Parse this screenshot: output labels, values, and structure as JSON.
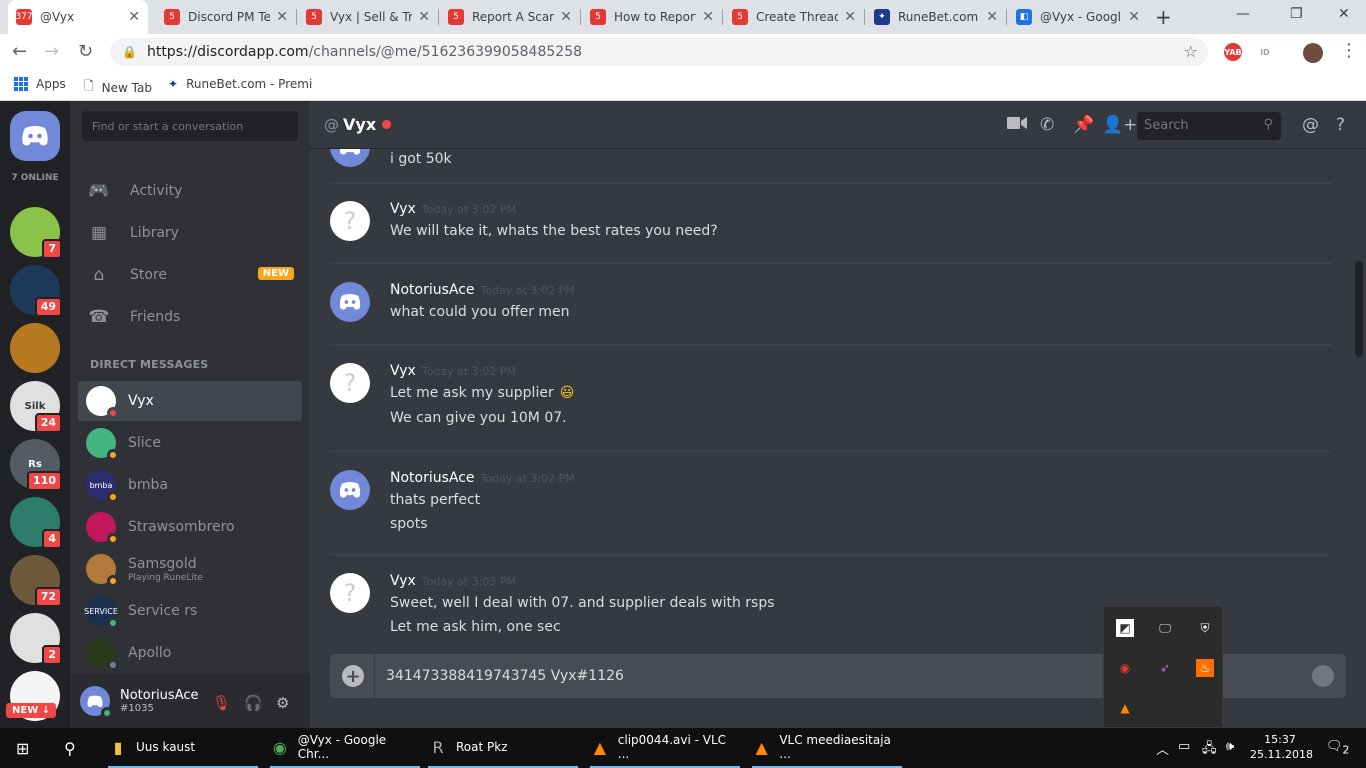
{
  "browser": {
    "tabs": [
      {
        "title": "@Vyx",
        "fav_text": "377",
        "fav_color": "#e53935",
        "active": true
      },
      {
        "title": "Discord PM Te",
        "fav_text": "5",
        "fav_color": "#e53935"
      },
      {
        "title": "Vyx | Sell & Tra",
        "fav_text": "5",
        "fav_color": "#e53935"
      },
      {
        "title": "Report A Scam",
        "fav_text": "5",
        "fav_color": "#e53935"
      },
      {
        "title": "How to Report",
        "fav_text": "5",
        "fav_color": "#e53935"
      },
      {
        "title": "Create Thread",
        "fav_text": "5",
        "fav_color": "#e53935"
      },
      {
        "title": "RuneBet.com -",
        "fav_text": "✦",
        "fav_color": "#1e3a8a"
      },
      {
        "title": "@Vyx - Googl",
        "fav_text": "◧",
        "fav_color": "#1a73e8"
      }
    ],
    "new_tab": "+",
    "window_controls": [
      "—",
      "❐",
      "✕"
    ],
    "url_host": "https://discordapp.com",
    "url_path": "/channels/@me/516236399058485258",
    "extensions": [
      {
        "text": "YAB",
        "color": "#e53935"
      },
      {
        "text": "iD",
        "color": "#9e9e9e"
      }
    ],
    "bookmarks": [
      {
        "label": "Apps",
        "icon": "apps-grid-icon"
      },
      {
        "label": "New Tab",
        "icon": "page-icon"
      },
      {
        "label": "RuneBet.com - Premi",
        "icon": "runebet-icon"
      }
    ]
  },
  "discord": {
    "online_count": "7 ONLINE",
    "guild_badges": [
      "7",
      "49",
      "",
      "24",
      "110",
      "4",
      "72",
      "2"
    ],
    "guild_colors": [
      "#8bc34a",
      "#1e3a5a",
      "#b7791f",
      "#e0e0e0",
      "#555b63",
      "#2e7d6a",
      "#6d5a3a",
      "#e0e0e0"
    ],
    "guild_labels": [
      "",
      "",
      "",
      "Silk",
      "Rs",
      "",
      "",
      ""
    ],
    "new_badge": "NEW ↓",
    "search_placeholder": "Find or start a conversation",
    "nav": [
      {
        "label": "Activity",
        "icon": "gamepad-icon"
      },
      {
        "label": "Library",
        "icon": "library-icon"
      },
      {
        "label": "Store",
        "icon": "store-icon",
        "tag": "NEW"
      },
      {
        "label": "Friends",
        "icon": "friends-icon"
      }
    ],
    "dm_header": "DIRECT MESSAGES",
    "dms": [
      {
        "name": "Vyx",
        "status": "#f04747",
        "avatar_color": "#ffffff",
        "selected": true
      },
      {
        "name": "Slice",
        "status": "#faa61a",
        "avatar_color": "#43b581"
      },
      {
        "name": "bmba",
        "status": "#faa61a",
        "avatar_color": "#2b2d6e",
        "avatar_text": "bmba"
      },
      {
        "name": "Strawsombrero",
        "status": "#faa61a",
        "avatar_color": "#c2185b"
      },
      {
        "name": "Samsgold",
        "status": "#faa61a",
        "avatar_color": "#b47a3c",
        "sub": "Playing RuneLite"
      },
      {
        "name": "Service rs",
        "status": "#43b581",
        "avatar_color": "#1b2f4f",
        "avatar_text": "SERVICE"
      },
      {
        "name": "Apollo",
        "status": "#747f8d",
        "avatar_color": "#2c3a1c"
      }
    ],
    "user": {
      "name": "NotoriusAce",
      "tag": "#1035"
    }
  },
  "chat": {
    "at": "@",
    "recipient": "Vyx",
    "search_placeholder": "Search",
    "header_icons": [
      "video-icon",
      "phone-icon",
      "pin-icon",
      "add-friend-icon",
      "mention-icon",
      "help-icon"
    ],
    "messages": [
      {
        "author": "",
        "time": "",
        "avatar": "d",
        "lines": [
          "i got 50k"
        ]
      },
      {
        "author": "Vyx",
        "time": "Today at 3:02 PM",
        "avatar": "q",
        "lines": [
          "We will take it, whats the best rates you need?"
        ]
      },
      {
        "author": "NotoriusAce",
        "time": "Today at 3:02 PM",
        "avatar": "d",
        "lines": [
          "what could you offer men"
        ]
      },
      {
        "author": "Vyx",
        "time": "Today at 3:02 PM",
        "avatar": "q",
        "lines": [
          "Let me ask my supplier",
          "We can give you 10M 07."
        ]
      },
      {
        "author": "NotoriusAce",
        "time": "Today at 3:02 PM",
        "avatar": "d",
        "lines": [
          "thats perfect",
          "spots"
        ]
      },
      {
        "author": "Vyx",
        "time": "Today at 3:03 PM",
        "avatar": "q",
        "lines": [
          "Sweet, well I deal with 07. and supplier deals with rsps",
          "Let me ask him, one sec"
        ]
      }
    ],
    "emoji": "😃",
    "input_value": "341473388419743745 Vyx#1126"
  },
  "taskbar": {
    "items": [
      {
        "label": "Uus kaust",
        "icon": "folder-icon",
        "color": "#f0c040"
      },
      {
        "label": "@Vyx - Google Chr...",
        "icon": "chrome-icon",
        "color": "#4caf50"
      },
      {
        "label": "Roat Pkz",
        "icon": "roat-icon",
        "color": "#aaaaaa"
      },
      {
        "label": "clip0044.avi - VLC ...",
        "icon": "vlc-icon",
        "color": "#ff8800"
      },
      {
        "label": "VLC meediaesitaja ...",
        "icon": "vlc-icon",
        "color": "#ff8800"
      }
    ],
    "time": "15:37",
    "date": "25.11.2018",
    "notifications": "2"
  }
}
